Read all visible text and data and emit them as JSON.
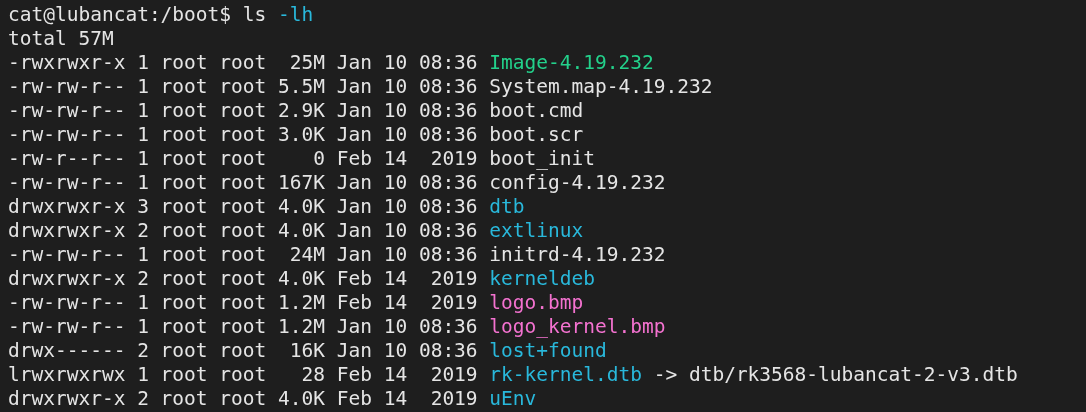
{
  "terminal": {
    "prompt": "cat@lubancat:/boot$",
    "command": "ls",
    "argument": "-lh",
    "total": "total 57M",
    "entries": [
      {
        "info": "-rwxrwxr-x 1 root root  25M Jan 10 08:36",
        "name": "Image-4.19.232",
        "kind": "executable"
      },
      {
        "info": "-rw-rw-r-- 1 root root 5.5M Jan 10 08:36",
        "name": "System.map-4.19.232",
        "kind": "file"
      },
      {
        "info": "-rw-rw-r-- 1 root root 2.9K Jan 10 08:36",
        "name": "boot.cmd",
        "kind": "file"
      },
      {
        "info": "-rw-rw-r-- 1 root root 3.0K Jan 10 08:36",
        "name": "boot.scr",
        "kind": "file"
      },
      {
        "info": "-rw-r--r-- 1 root root    0 Feb 14  2019",
        "name": "boot_init",
        "kind": "file"
      },
      {
        "info": "-rw-rw-r-- 1 root root 167K Jan 10 08:36",
        "name": "config-4.19.232",
        "kind": "file"
      },
      {
        "info": "drwxrwxr-x 3 root root 4.0K Jan 10 08:36",
        "name": "dtb",
        "kind": "directory"
      },
      {
        "info": "drwxrwxr-x 2 root root 4.0K Jan 10 08:36",
        "name": "extlinux",
        "kind": "directory"
      },
      {
        "info": "-rw-rw-r-- 1 root root  24M Jan 10 08:36",
        "name": "initrd-4.19.232",
        "kind": "file"
      },
      {
        "info": "drwxrwxr-x 2 root root 4.0K Feb 14  2019",
        "name": "kerneldeb",
        "kind": "directory"
      },
      {
        "info": "-rw-rw-r-- 1 root root 1.2M Feb 14  2019",
        "name": "logo.bmp",
        "kind": "image"
      },
      {
        "info": "-rw-rw-r-- 1 root root 1.2M Jan 10 08:36",
        "name": "logo_kernel.bmp",
        "kind": "image"
      },
      {
        "info": "drwx------ 2 root root  16K Jan 10 08:36",
        "name": "lost+found",
        "kind": "directory"
      },
      {
        "info": "lrwxrwxrwx 1 root root   28 Feb 14  2019",
        "name": "rk-kernel.dtb",
        "kind": "symlink",
        "target": "-> dtb/rk3568-lubancat-2-v3.dtb"
      },
      {
        "info": "drwxrwxr-x 2 root root 4.0K Feb 14  2019",
        "name": "uEnv",
        "kind": "directory"
      }
    ]
  }
}
